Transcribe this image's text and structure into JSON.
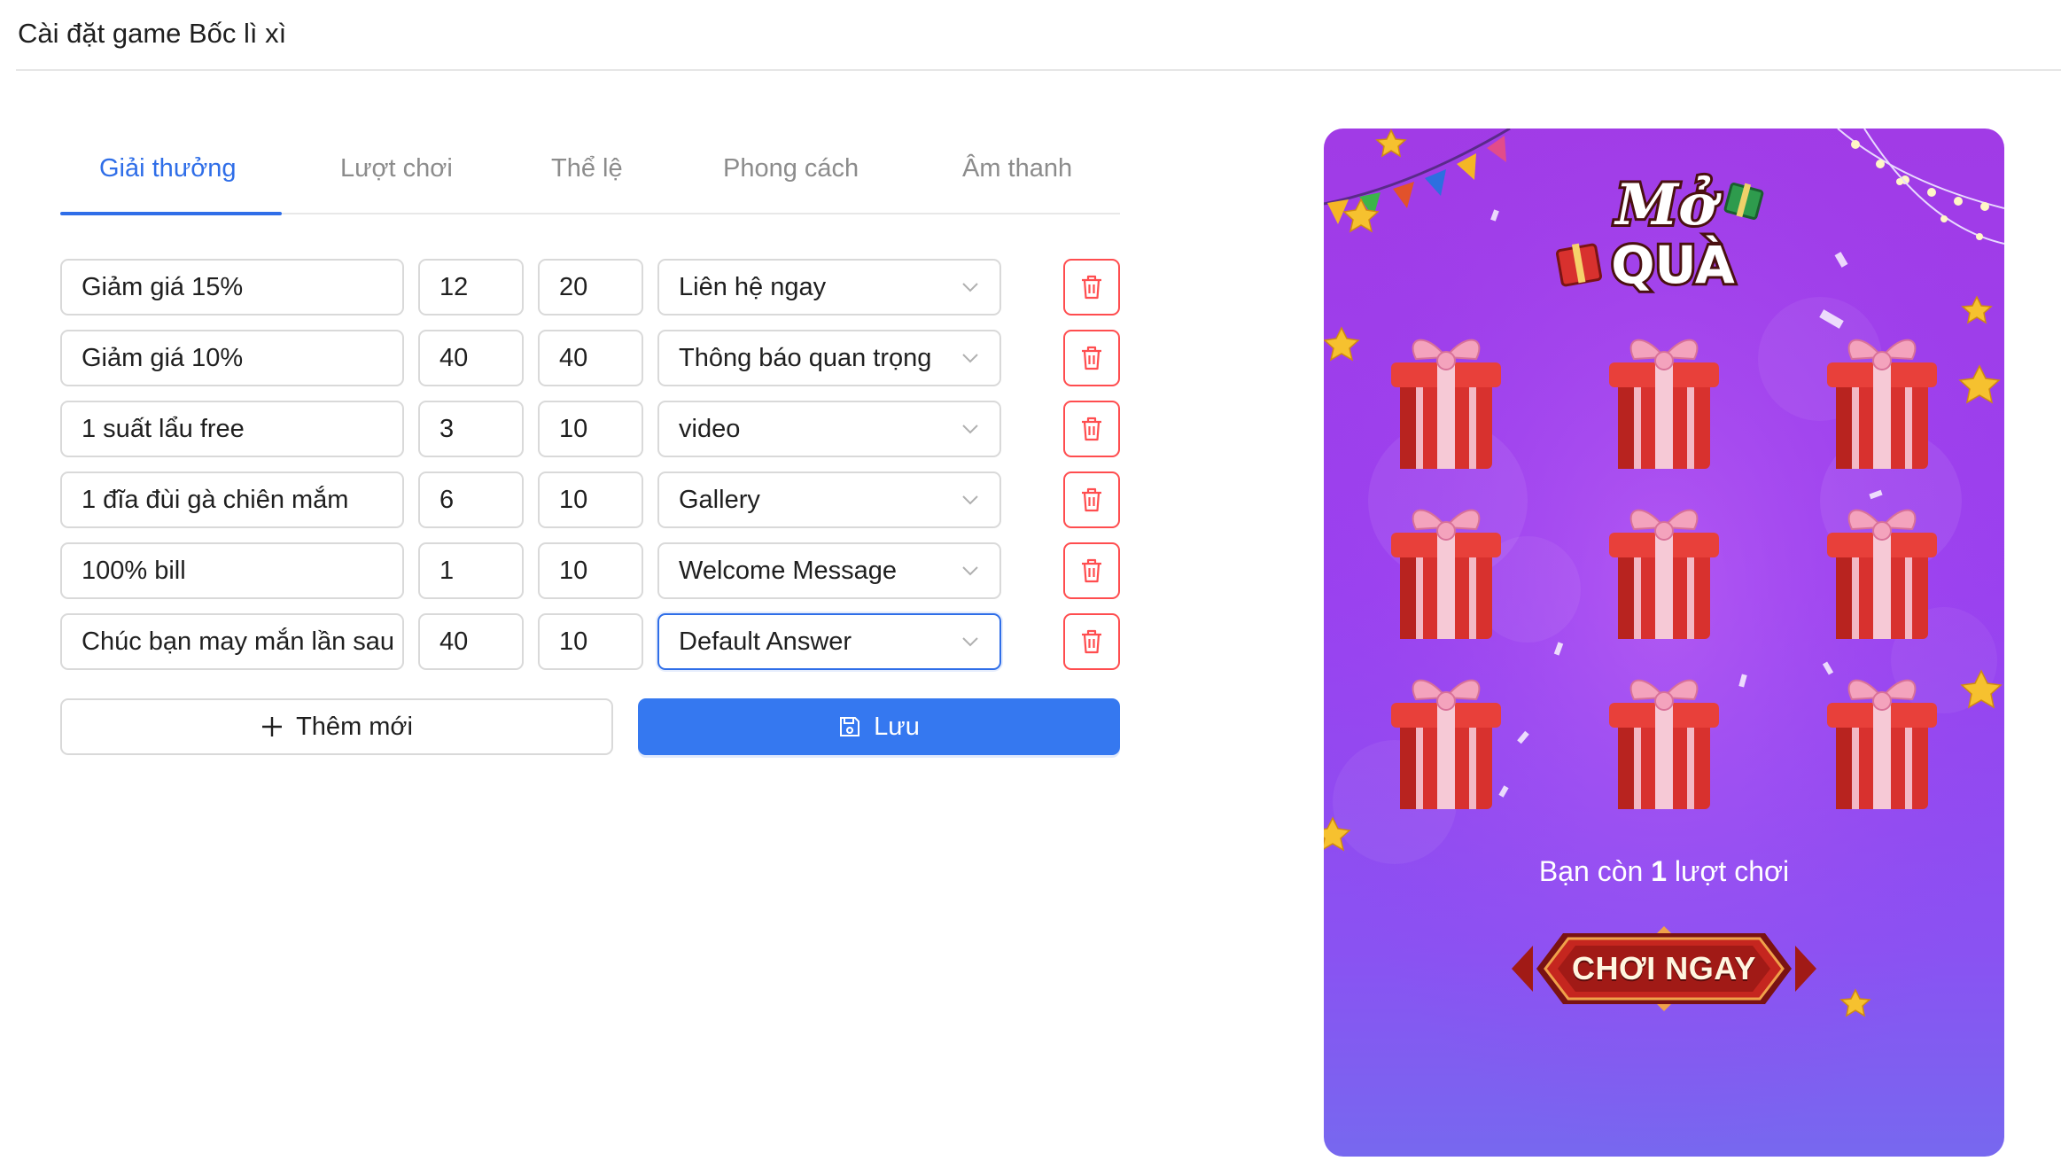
{
  "page": {
    "title": "Cài đặt game Bốc lì xì"
  },
  "tabs": [
    {
      "label": "Giải thưởng",
      "active": true
    },
    {
      "label": "Lượt chơi",
      "active": false
    },
    {
      "label": "Thể lệ",
      "active": false
    },
    {
      "label": "Phong cách",
      "active": false
    },
    {
      "label": "Âm thanh",
      "active": false
    }
  ],
  "prizes": [
    {
      "name": "Giảm giá 15%",
      "qty": "12",
      "rate": "20",
      "action": "Liên hệ ngay"
    },
    {
      "name": "Giảm giá 10%",
      "qty": "40",
      "rate": "40",
      "action": "Thông báo quan trọng"
    },
    {
      "name": "1 suất lẩu free",
      "qty": "3",
      "rate": "10",
      "action": "video"
    },
    {
      "name": "1 đĩa đùi gà chiên mắm",
      "qty": "6",
      "rate": "10",
      "action": "Gallery"
    },
    {
      "name": "100% bill",
      "qty": "1",
      "rate": "10",
      "action": "Welcome Message"
    },
    {
      "name": "Chúc bạn may mắn lần sau",
      "qty": "40",
      "rate": "10",
      "action": "Default Answer"
    }
  ],
  "buttons": {
    "add_label": "Thêm mới",
    "save_label": "Lưu"
  },
  "preview": {
    "logo_line1": "Mở",
    "logo_line2": "QUÀ",
    "turns_prefix": "Bạn còn",
    "turns_count": "1",
    "turns_suffix": "lượt chơi",
    "play_label": "CHƠI NGAY"
  },
  "icons": {
    "plus": "plus-icon",
    "save": "save-icon",
    "delete": "trash-icon",
    "dropdown": "chevron-down-icon"
  },
  "colors": {
    "primary": "#3578f0",
    "danger": "#ff4d4f",
    "preview_bg_top": "#a13be6",
    "preview_bg_bottom": "#7768ef",
    "gift_red": "#d8312e",
    "play_button": "#b71f1c"
  }
}
